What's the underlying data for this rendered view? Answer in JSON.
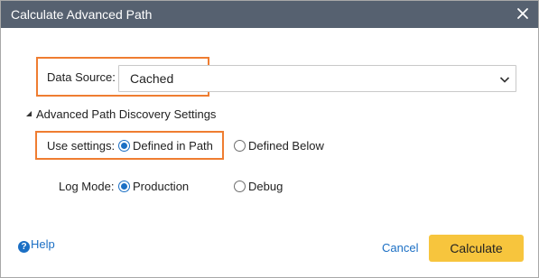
{
  "dialog": {
    "title": "Calculate Advanced Path"
  },
  "data_source": {
    "label": "Data Source:",
    "value": "Cached"
  },
  "advanced": {
    "header": "Advanced Path Discovery Settings",
    "use_settings": {
      "label": "Use settings:",
      "options": [
        {
          "label": "Defined in Path",
          "selected": true
        },
        {
          "label": "Defined Below",
          "selected": false
        }
      ]
    },
    "log_mode": {
      "label": "Log Mode:",
      "options": [
        {
          "label": "Production",
          "selected": true
        },
        {
          "label": "Debug",
          "selected": false
        }
      ]
    }
  },
  "footer": {
    "help_label": "Help",
    "cancel_label": "Cancel",
    "calculate_label": "Calculate"
  },
  "colors": {
    "titlebar": "#566170",
    "highlight_border": "#ef7d31",
    "link": "#1b6fc4",
    "primary_button": "#f7c53d"
  }
}
